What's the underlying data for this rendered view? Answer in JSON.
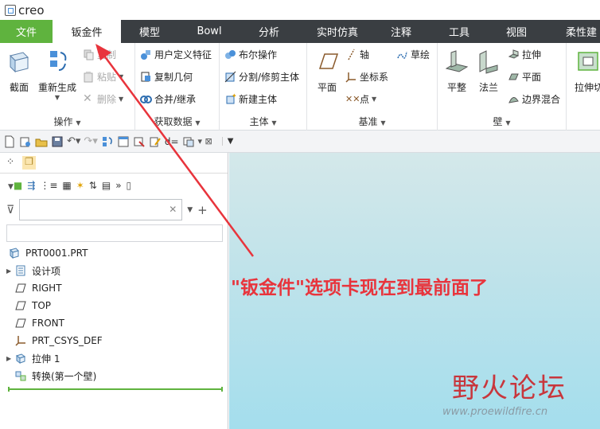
{
  "app": {
    "logo": "creo"
  },
  "tabs": [
    {
      "label": "文件"
    },
    {
      "label": "钣金件"
    },
    {
      "label": "模型"
    },
    {
      "label": "Bowl"
    },
    {
      "label": "分析"
    },
    {
      "label": "实时仿真"
    },
    {
      "label": "注释"
    },
    {
      "label": "工具"
    },
    {
      "label": "视图"
    },
    {
      "label": "柔性建"
    }
  ],
  "ribbon": {
    "operations": {
      "label": "操作",
      "section": "截面",
      "regenerate": "重新生成",
      "copy": "复制",
      "paste": "粘贴",
      "delete": "删除"
    },
    "get_data": {
      "label": "获取数据",
      "udf": "用户定义特征",
      "copy_geom": "复制几何",
      "merge": "合并/继承"
    },
    "body": {
      "label": "主体",
      "boolean": "布尔操作",
      "split": "分割/修剪主体",
      "new_body": "新建主体"
    },
    "datum": {
      "label": "基准",
      "plane": "平面",
      "axis": "轴",
      "csys": "坐标系",
      "point": "点",
      "sketch": "草绘"
    },
    "wall": {
      "label": "壁",
      "flat": "平整",
      "flange": "法兰",
      "extrude": "拉伸",
      "planar": "平面",
      "blend": "边界混合",
      "extrude_cut": "拉伸切"
    }
  },
  "model_tree": {
    "root": "PRT0001.PRT",
    "items": [
      {
        "label": "设计项",
        "expandable": true
      },
      {
        "label": "RIGHT",
        "expandable": false
      },
      {
        "label": "TOP",
        "expandable": false
      },
      {
        "label": "FRONT",
        "expandable": false
      },
      {
        "label": "PRT_CSYS_DEF",
        "expandable": false
      },
      {
        "label": "拉伸 1",
        "expandable": true
      },
      {
        "label": "转换(第一个壁)",
        "expandable": false
      }
    ]
  },
  "annotation": {
    "text": "\"钣金件\"选项卡现在到最前面了"
  },
  "watermark": {
    "title": "野火论坛",
    "url": "www.proewildfire.cn"
  },
  "colors": {
    "file_tab": "#5fb33e",
    "tabbar": "#3a3e42",
    "annotation": "#e8343c"
  }
}
